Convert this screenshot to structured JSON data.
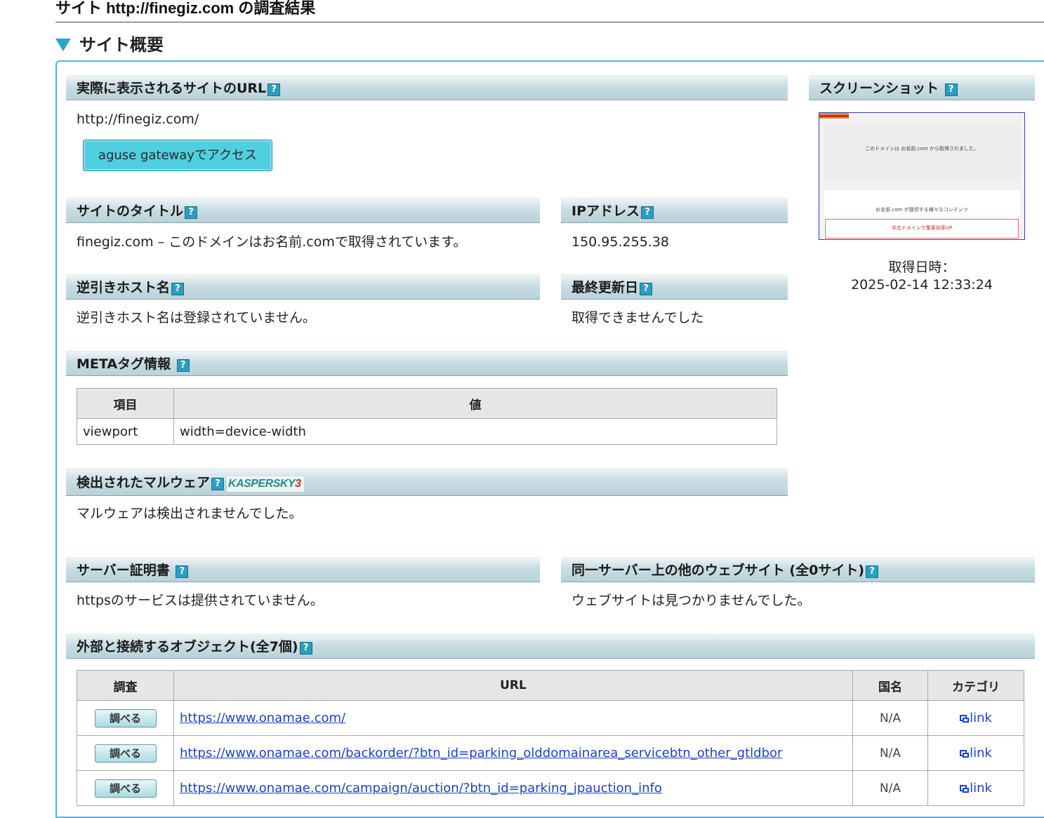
{
  "page_title": "サイト http://finegiz.com の調査結果",
  "section_title": "サイト概要",
  "url_section": {
    "header": "実際に表示されるサイトのURL",
    "value": "http://finegiz.com/",
    "gateway_button": "aguse gatewayでアクセス"
  },
  "screenshot": {
    "header": "スクリーンショット",
    "image_text_main": "このドメインは お名前.com から取得されました。",
    "image_text_sub": "お名前.com が提供する様々なコンテンツ",
    "image_text_red": "中古ドメインで集客効率UP",
    "caption_label": "取得日時：",
    "caption_value": "2025-02-14 12:33:24"
  },
  "title_section": {
    "header": "サイトのタイトル",
    "value": "finegiz.com – このドメインはお名前.comで取得されています。"
  },
  "ip_section": {
    "header": "IPアドレス",
    "value": "150.95.255.38"
  },
  "reverse_host": {
    "header": "逆引きホスト名",
    "value": "逆引きホスト名は登録されていません。"
  },
  "last_modified": {
    "header": "最終更新日",
    "value": "取得できませんでした"
  },
  "meta_section": {
    "header": "METAタグ情報",
    "columns": [
      "項目",
      "値"
    ],
    "rows": [
      [
        "viewport",
        "width=device-width"
      ]
    ]
  },
  "malware": {
    "header": "検出されたマルウェア",
    "vendor_logo": "KASPERSKY",
    "value": "マルウェアは検出されませんでした。"
  },
  "certificate": {
    "header": "サーバー証明書",
    "value": "httpsのサービスは提供されていません。"
  },
  "same_server": {
    "header": "同一サーバー上の他のウェブサイト (全0サイト)",
    "value": "ウェブサイトは見つかりませんでした。"
  },
  "external_objects": {
    "header": "外部と接続するオブジェクト(全7個)",
    "columns": [
      "調査",
      "URL",
      "国名",
      "カテゴリ"
    ],
    "check_label": "調べる",
    "link_label": "link",
    "rows": [
      {
        "url": "https://www.onamae.com/",
        "country": "N/A"
      },
      {
        "url": "https://www.onamae.com/backorder/?btn_id=parking_olddomainarea_servicebtn_other_gtldbor",
        "country": "N/A"
      },
      {
        "url": "https://www.onamae.com/campaign/auction/?btn_id=parking_jpauction_info",
        "country": "N/A"
      }
    ]
  },
  "help_icon": "?",
  "colors": {
    "accent": "#2aa6c6",
    "panel_border": "#4eb7d2",
    "link": "#1a44cc"
  }
}
